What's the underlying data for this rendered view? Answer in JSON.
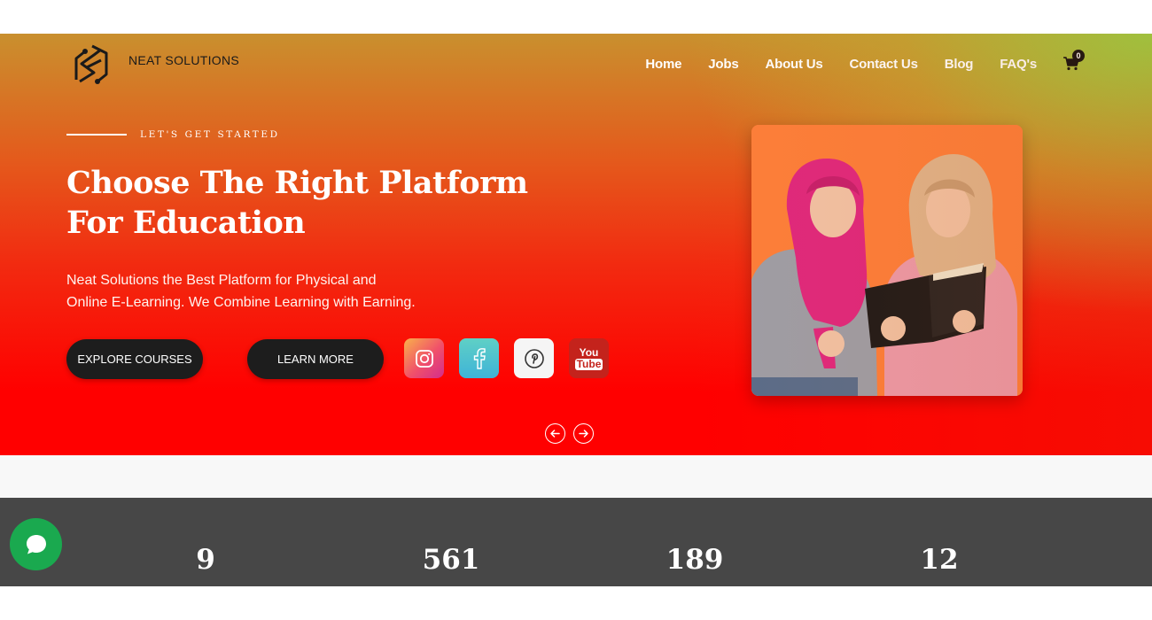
{
  "brand": {
    "name": "NEAT SOLUTIONS",
    "logo_icon": "ns-monogram-icon"
  },
  "nav": {
    "items": [
      "Home",
      "Jobs",
      "About Us",
      "Contact Us",
      "Blog",
      "FAQ's"
    ],
    "cart_count": "0",
    "cart_icon": "cart-icon"
  },
  "hero": {
    "eyebrow": "LET'S GET STARTED",
    "title_line1": "Choose The Right Platform",
    "title_line2": "For Education",
    "description_line1": "Neat Solutions the Best Platform for Physical and",
    "description_line2": "Online E-Learning. We Combine Learning with Earning.",
    "explore_label": "EXPLORE COURSES",
    "learn_label": "LEARN MORE",
    "socials": [
      "instagram-icon",
      "facebook-icon",
      "pinterest-icon",
      "youtube-icon"
    ],
    "youtube_text_top": "You",
    "youtube_text_bottom": "Tube",
    "image": "two-students-reading-book-photo"
  },
  "stats": {
    "values": [
      "9",
      "561",
      "189",
      "12"
    ]
  },
  "colors": {
    "hero_top_right": "#9ad64a",
    "hero_bottom": "#ff0000",
    "button_bg": "#1d1d1d",
    "stats_bg": "#474747",
    "chat_bg": "#1aa94f",
    "photo_bg": "#fd7f3a"
  }
}
